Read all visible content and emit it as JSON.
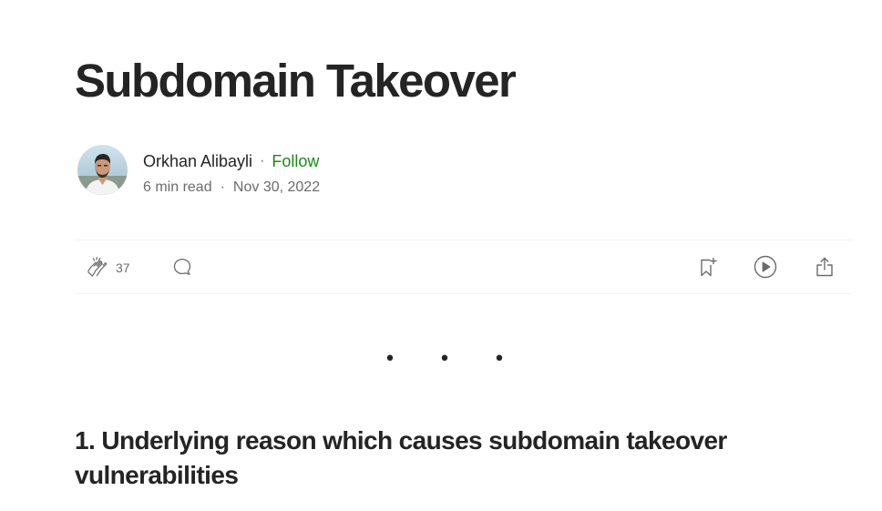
{
  "article": {
    "title": "Subdomain Takeover",
    "author": {
      "name": "Orkhan Alibayli",
      "follow_label": "Follow",
      "avatar_icon": "author-avatar-photo"
    },
    "separator": "·",
    "read_time": "6 min read",
    "date": "Nov 30, 2022"
  },
  "actions": {
    "clap_icon": "clap-icon",
    "clap_count": "37",
    "response_icon": "speech-bubble-icon",
    "save_icon": "bookmark-plus-icon",
    "listen_icon": "play-circle-icon",
    "share_icon": "share-upload-icon"
  },
  "divider": "• • •",
  "section": {
    "heading": "1. Underlying reason which causes subdomain takeover vulnerabilities"
  },
  "colors": {
    "text": "#242424",
    "muted": "#6b6b6b",
    "follow_green": "#1a8917",
    "border": "#f2f2f2"
  }
}
